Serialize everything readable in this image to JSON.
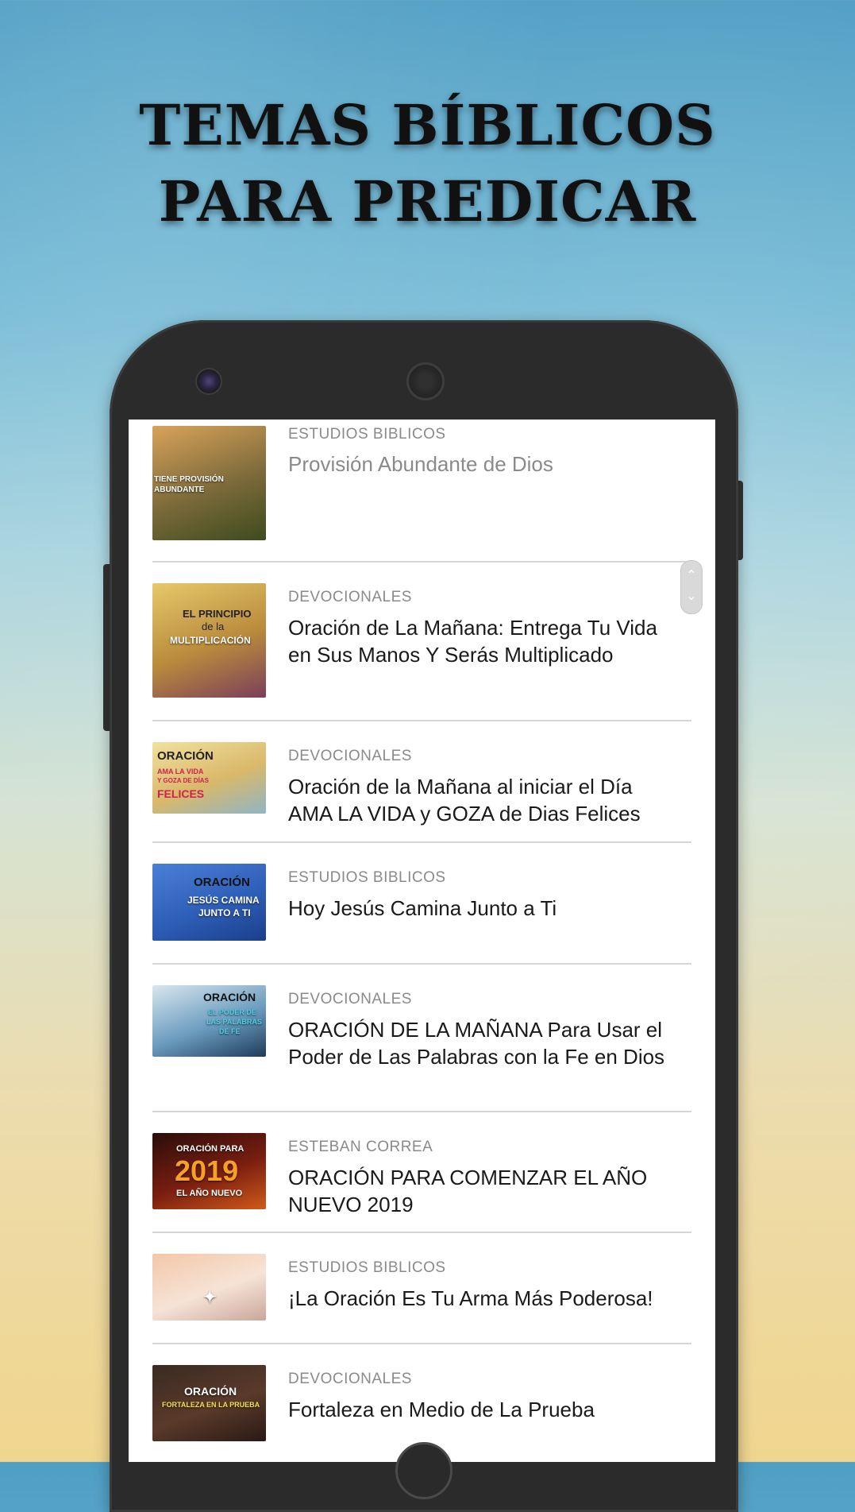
{
  "headline": {
    "line1": "TEMAS BÍBLICOS",
    "line2": "PARA PREDICAR"
  },
  "scroll": {
    "up": "⌃",
    "down": "⌄"
  },
  "items": [
    {
      "category": "ESTUDIOS BIBLICOS",
      "title": "Provisión Abundante de Dios",
      "thumb_text": [
        "TIENE PROVISIÓN",
        "ABUNDANTE"
      ],
      "thumb_colors": [
        "#d9a35a",
        "#7c6a3a",
        "#3e4b1e"
      ]
    },
    {
      "category": "DEVOCIONALES",
      "title": "Oración de La Mañana: Entrega Tu Vida en Sus Manos Y Serás Multiplicado",
      "thumb_text": [
        "EL PRINCIPIO",
        "de la",
        "MULTIPLICACIÓN"
      ],
      "thumb_colors": [
        "#e6c96a",
        "#b98a3c",
        "#7a3f5a"
      ]
    },
    {
      "category": "DEVOCIONALES",
      "title": "Oración de la Mañana al iniciar el Día AMA LA VIDA y GOZA de Dias Felices",
      "thumb_text": [
        "ORACIÓN",
        "AMA LA VIDA",
        "Y GOZA DE DÍAS",
        "FELICES"
      ],
      "thumb_colors": [
        "#f1e1a0",
        "#d9b86a",
        "#8fb6c4"
      ]
    },
    {
      "category": "ESTUDIOS BIBLICOS",
      "title": "Hoy Jesús Camina Junto a Ti",
      "thumb_text": [
        "ORACIÓN",
        "JESÚS CAMINA",
        "JUNTO A TI"
      ],
      "thumb_colors": [
        "#4b7fd6",
        "#2e5fb8",
        "#1b3f8a"
      ]
    },
    {
      "category": "DEVOCIONALES",
      "title": "ORACIÓN DE LA MAÑANA Para Usar el Poder de Las Palabras con la Fe en Dios",
      "thumb_text": [
        "ORACIÓN",
        "EL PODER DE",
        "LAS PALABRAS",
        "DE FE"
      ],
      "thumb_colors": [
        "#d9e6ee",
        "#6b9cbf",
        "#1f3b5a"
      ]
    },
    {
      "category": "ESTEBAN CORREA",
      "title": "ORACIÓN PARA COMENZAR EL AÑO NUEVO 2019",
      "thumb_text": [
        "ORACIÓN PARA",
        "2019",
        "EL AÑO NUEVO"
      ],
      "thumb_colors": [
        "#2a0d0a",
        "#7a1e10",
        "#d05a1a"
      ]
    },
    {
      "category": "ESTUDIOS BIBLICOS",
      "title": "¡La Oración Es Tu Arma Más Poderosa!",
      "thumb_text": [],
      "thumb_colors": [
        "#f3c7a8",
        "#f6e3d6",
        "#c9a79a"
      ]
    },
    {
      "category": "DEVOCIONALES",
      "title": "Fortaleza en Medio de La Prueba",
      "thumb_text": [
        "ORACIÓN",
        "FORTALEZA EN LA PRUEBA"
      ],
      "thumb_colors": [
        "#3a2a22",
        "#5a3a2a",
        "#2a1a15"
      ]
    }
  ]
}
